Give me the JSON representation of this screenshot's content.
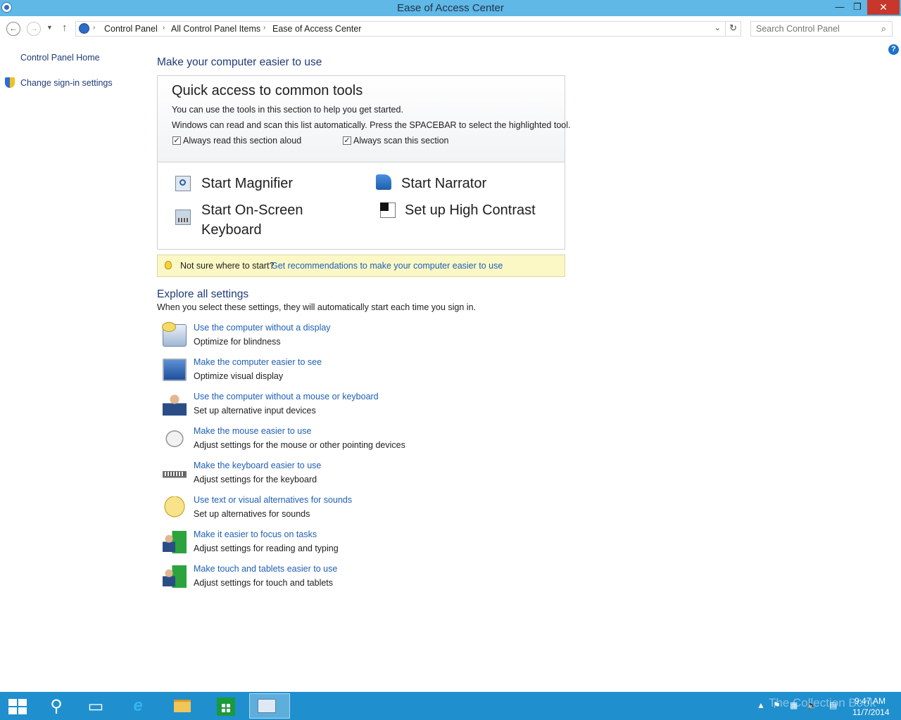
{
  "window": {
    "title": "Ease of Access Center",
    "minimize": "—",
    "maximize": "❐",
    "close": "✕"
  },
  "nav": {
    "back": "←",
    "forward": "→",
    "recent": "▼",
    "up": "↑"
  },
  "address": {
    "crumbs": [
      "Control Panel",
      "All Control Panel Items",
      "Ease of Access Center"
    ],
    "separator": "›",
    "dropdown": "⌄",
    "refresh": "↻"
  },
  "search": {
    "placeholder": "Search Control Panel",
    "icon": "⌕"
  },
  "help": {
    "glyph": "?"
  },
  "sidebar": {
    "home": "Control Panel Home",
    "signin": "Change sign-in settings"
  },
  "main": {
    "heading": "Make your computer easier to use",
    "quick": {
      "title": "Quick access to common tools",
      "line1": "You can use the tools in this section to help you get started.",
      "line2": "Windows can read and scan this list automatically.  Press the SPACEBAR to select the highlighted tool.",
      "check_read": {
        "label": "Always read this section aloud",
        "checked": true,
        "mark": "✓"
      },
      "check_scan": {
        "label": "Always scan this section",
        "checked": true,
        "mark": "✓"
      },
      "tools": {
        "magnifier": "Start Magnifier",
        "narrator": "Start Narrator",
        "osk_line1": "Start On-Screen",
        "osk_line2": "Keyboard",
        "contrast": "Set up High Contrast"
      }
    },
    "tip": {
      "static": "Not sure where to start?",
      "link": "Get recommendations to make your computer easier to use"
    },
    "explore": {
      "title": "Explore all settings",
      "subtitle": "When you select these settings, they will automatically start each time you sign in.",
      "items": [
        {
          "link": "Use the computer without a display",
          "desc": "Optimize for blindness",
          "icon": "monitor-speech-icon"
        },
        {
          "link": "Make the computer easier to see",
          "desc": "Optimize visual display",
          "icon": "monitor-icon"
        },
        {
          "link": "Use the computer without a mouse or keyboard",
          "desc": "Set up alternative input devices",
          "icon": "person-icon"
        },
        {
          "link": "Make the mouse easier to use",
          "desc": "Adjust settings for the mouse or other pointing devices",
          "icon": "mouse-icon"
        },
        {
          "link": "Make the keyboard easier to use",
          "desc": "Adjust settings for the keyboard",
          "icon": "keyboard-icon"
        },
        {
          "link": "Use text or visual alternatives for sounds",
          "desc": "Set up alternatives for sounds",
          "icon": "speech-bubble-icon"
        },
        {
          "link": "Make it easier to focus on tasks",
          "desc": "Adjust settings for reading and typing",
          "icon": "person-task-icon"
        },
        {
          "link": "Make touch and tablets easier to use",
          "desc": "Adjust settings for touch and tablets",
          "icon": "person-task-icon"
        }
      ]
    }
  },
  "taskbar": {
    "search_glyph": "⚲",
    "files_glyph": "▭",
    "ie_glyph": "e",
    "tray": {
      "arrow": "▲",
      "flag": "⚑",
      "network": "▦",
      "volume": "🔈",
      "keyboard": "▤"
    },
    "watermark": "The Collection Book",
    "time": "9:47 AM",
    "date": "11/7/2014"
  }
}
